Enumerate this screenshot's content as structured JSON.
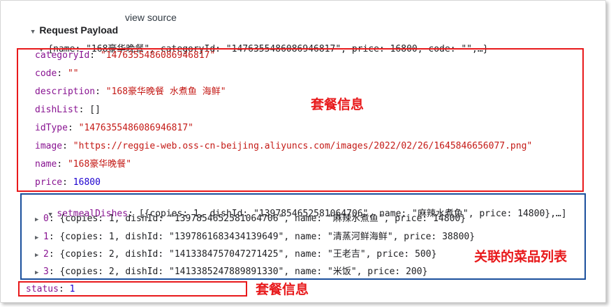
{
  "header": {
    "title": "Request Payload",
    "view_source": "view source"
  },
  "summary": {
    "open": "{",
    "text": "name: \"168豪华晚餐\", categoryId: \"1476355486086946817\", price: 16800, code: \"\",…}"
  },
  "fields": [
    {
      "key": "categoryId",
      "value": "\"1476355486086946817\"",
      "type": "str"
    },
    {
      "key": "code",
      "value": "\"\"",
      "type": "str"
    },
    {
      "key": "description",
      "value": "\"168豪华晚餐 水煮鱼 海鲜\"",
      "type": "str"
    },
    {
      "key": "dishList",
      "value": "[]",
      "type": "plain"
    },
    {
      "key": "idType",
      "value": "\"1476355486086946817\"",
      "type": "str"
    },
    {
      "key": "image",
      "value": "\"https://reggie-web.oss-cn-beijing.aliyuncs.com/images/2022/02/26/1645846656077.png\"",
      "type": "str"
    },
    {
      "key": "name",
      "value": "\"168豪华晚餐\"",
      "type": "str"
    },
    {
      "key": "price",
      "value": "16800",
      "type": "num"
    }
  ],
  "setmeal": {
    "key": "setmealDishes",
    "summary": "[{copies: 1, dishId: \"1397854652581064706\", name: \"麻辣水煮鱼\", price: 14800},…]",
    "items": [
      {
        "index": "0",
        "text": "{copies: 1, dishId: \"1397854652581064706\", name: \"麻辣水煮鱼\", price: 14800}"
      },
      {
        "index": "1",
        "text": "{copies: 1, dishId: \"1397861683434139649\", name: \"清蒸河鲜海鲜\", price: 38800}"
      },
      {
        "index": "2",
        "text": "{copies: 2, dishId: \"1413384757047271425\", name: \"王老吉\", price: 500}"
      },
      {
        "index": "3",
        "text": "{copies: 2, dishId: \"1413385247889891330\", name: \"米饭\", price: 200}"
      }
    ]
  },
  "status": {
    "key": "status",
    "value": "1"
  },
  "annotations": {
    "setmeal_info": "套餐信息",
    "dish_list": "关联的菜品列表",
    "status_info": "套餐信息"
  },
  "colors": {
    "highlight_red": "#e8191b",
    "highlight_blue": "#1a4f9c",
    "key_purple": "#881391",
    "string_red": "#c41a16",
    "number_blue": "#1c00cf"
  },
  "icons": {
    "expanded": "triangle-down",
    "collapsed": "triangle-right"
  }
}
